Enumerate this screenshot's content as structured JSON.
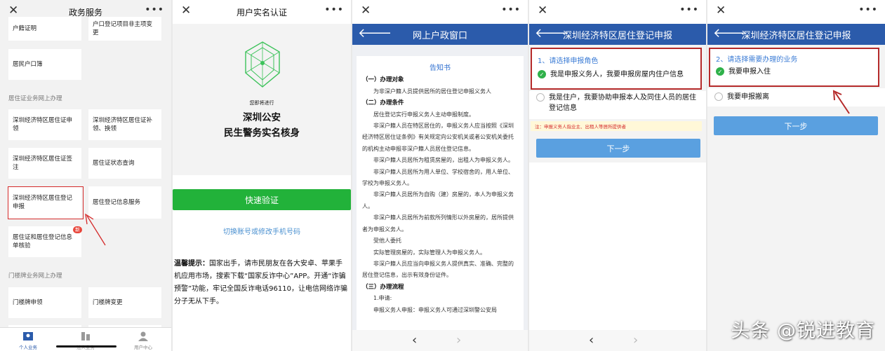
{
  "p1": {
    "title": "政务服务",
    "tiles": [
      "户籍证明",
      "户口登记项目非主项变更",
      "居民户口簿",
      "深圳经济特区居住证申领",
      "深圳经济特区居住证补领、换领",
      "深圳经济特区居住证签注",
      "居住证状态查询",
      "深圳经济特区居住登记申报",
      "居住登记信息服务",
      "居住证和居住登记信息单核验",
      "门楼牌申领",
      "门楼牌变更"
    ],
    "section_residence": "居住证业务网上办理",
    "section_door": "门楼牌业务网上办理",
    "badge": "新",
    "tabs": [
      "个人业务",
      "法人业务",
      "用户中心"
    ]
  },
  "p2": {
    "title": "用户实名认证",
    "about_to": "您即将进行",
    "hero_line1": "深圳公安",
    "hero_line2": "民生警务实名核身",
    "verify_button": "快速验证",
    "switch_link": "切换账号或修改手机号码",
    "tip_label": "温馨提示：",
    "tip_text": "国家出手，请市民朋友在各大安卓、苹果手机应用市场，搜索下载“国家反诈中心”APP。开通“诈骗预警”功能，牢记全国反诈电话96110，让电信网络诈骗分子无从下手。"
  },
  "p3": {
    "title": "网上户政窗口",
    "doc_title": "告知书",
    "h1": "（一）办理对象",
    "l1": "为非深户籍人员提供居所的居住登记申报义务人",
    "h2": "（二）办理条件",
    "l2": "居住登记实行申报义务人主动申报制度。",
    "l3": "非深户籍人员在特区居住的，申报义务人应当按照《深圳经济特区居住证条例》有关规定向公安机关或者公安机关委托的机构主动申报非深户籍人员居住登记信息。",
    "l4": "非深户籍人员居所为租赁房屋的，出租人为申报义务人。",
    "l5": "非深户籍人员居所为用人单位、学校宿舍的，用人单位、学校为申报义务人。",
    "l6": "非深户籍人员居所为自购（建）房屋的，本人为申报义务人。",
    "l7": "非深户籍人员居所为前款所列情形以外房屋的，居所提供者为申报义务人。",
    "l8": "受他人委托",
    "l9": "实际管理房屋的，实际管理人为申报义务人。",
    "l10": "非深户籍人员应当向申报义务人提供真实、准确、完整的居住登记信息，出示有效身份证件。",
    "h3": "（三）办理流程",
    "l11": "1.申请:",
    "l12": "申报义务人申报：申报义务人可通过深圳警公安局"
  },
  "p4": {
    "title": "深圳经济特区居住登记申报",
    "question": "1、请选择申报角色",
    "opt1": "我是申报义务人，我要申报房屋内住户信息",
    "opt2": "我是住户，我要协助申报本人及同住人员的居住登记信息",
    "note": "注：申报义务人指业主、出租人等居所提供者",
    "next": "下一步"
  },
  "p5": {
    "title": "深圳经济特区居住登记申报",
    "question": "2、请选择需要办理的业务",
    "opt1": "我要申报入住",
    "opt2": "我要申报搬离",
    "next": "下一步"
  },
  "watermark": "头条 @锐进教育",
  "colors": {
    "blue_header": "#2b5bab",
    "green": "#22b23a",
    "accent_red": "#d42a2a",
    "link_blue": "#4a90d0"
  }
}
